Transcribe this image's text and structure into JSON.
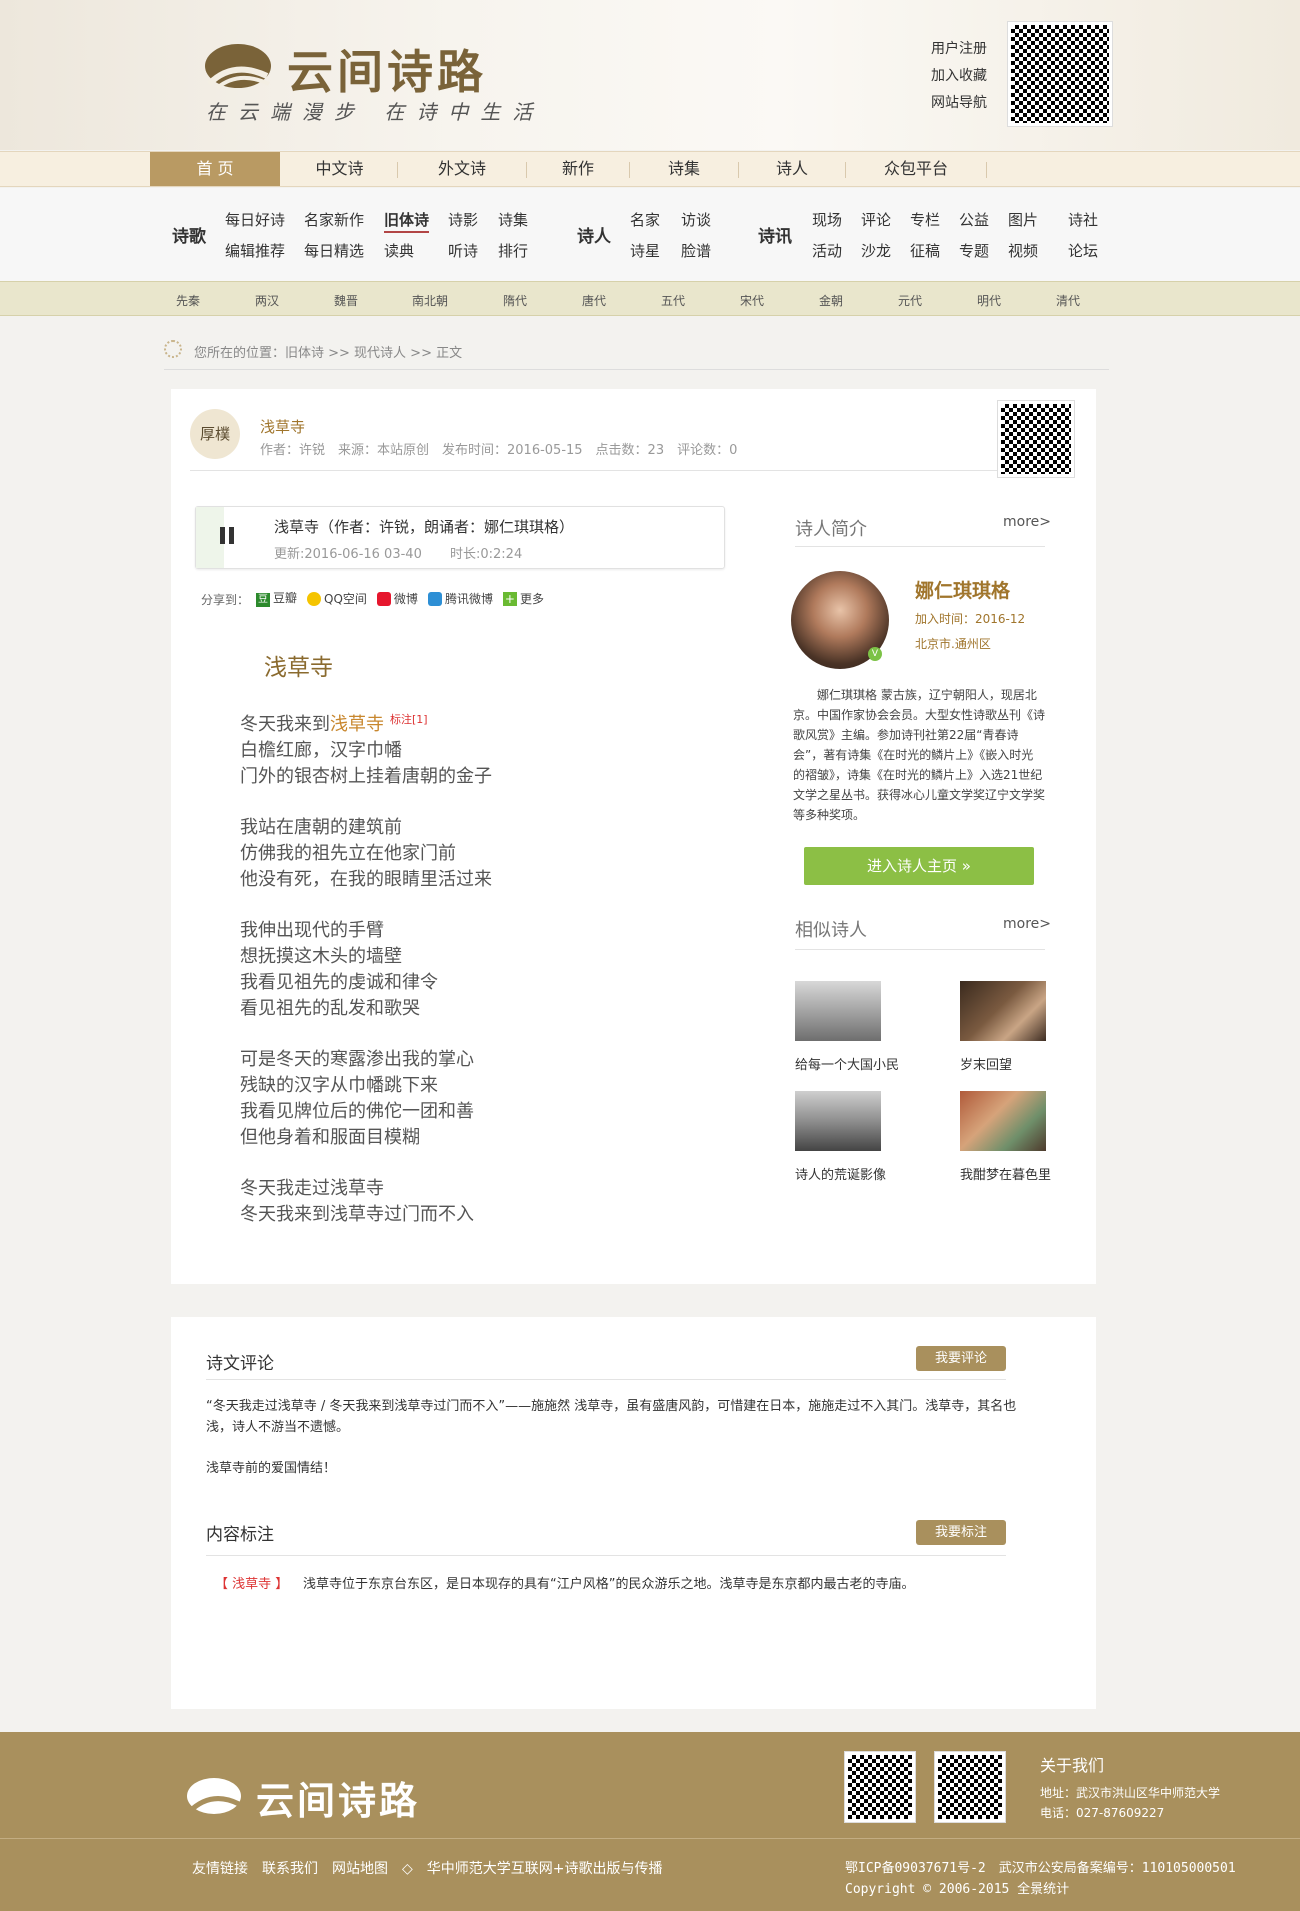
{
  "header": {
    "logo_text": "云间诗路",
    "slogan": "在云端漫步  在诗中生活",
    "links": [
      "用户注册",
      "加入收藏",
      "网站导航"
    ]
  },
  "mainnav": {
    "tabs": [
      "首 页",
      "中文诗",
      "外文诗",
      "新作",
      "诗集",
      "诗人",
      "众包平台"
    ]
  },
  "subnav": {
    "poetry": {
      "label": "诗歌",
      "row1": [
        "每日好诗",
        "名家新作",
        "旧体诗",
        "诗影",
        "诗集"
      ],
      "row2": [
        "编辑推荐",
        "每日精选",
        "读典",
        "听诗",
        "排行"
      ]
    },
    "poet": {
      "label": "诗人",
      "row1": [
        "名家",
        "访谈"
      ],
      "row2": [
        "诗星",
        "脸谱"
      ]
    },
    "news": {
      "label": "诗讯",
      "row1": [
        "现场",
        "评论",
        "专栏",
        "公益",
        "图片",
        "诗社"
      ],
      "row2": [
        "活动",
        "沙龙",
        "征稿",
        "专题",
        "视频",
        "论坛"
      ]
    },
    "dynasties": [
      "先秦",
      "两汉",
      "魏晋",
      "南北朝",
      "隋代",
      "唐代",
      "五代",
      "宋代",
      "金朝",
      "元代",
      "明代",
      "清代"
    ]
  },
  "breadcrumb": "您所在的位置：旧体诗 >> 现代诗人 >> 正文",
  "article": {
    "avatar_text": "厚樸",
    "title": "浅草寺",
    "meta": "作者：许锐　来源：本站原创　发布时间：2016-05-15　点击数：23　评论数：0",
    "audio": {
      "title": "浅草寺（作者：许锐，朗诵者：娜仁琪琪格）",
      "updated": "更新:2016-06-16 03-40",
      "duration": "时长:0:2:24"
    },
    "share": {
      "label": "分享到：",
      "items": [
        "豆瓣",
        "QQ空间",
        "微博",
        "腾讯微博",
        "更多"
      ]
    },
    "poem_title": "浅草寺",
    "first_line_prefix": "冬天我来到",
    "first_line_highlight": "浅草寺",
    "annotation_mark": "标注[1]",
    "stanzas": [
      [
        "白檐红廊，汉字巾幡",
        "门外的银杏树上挂着唐朝的金子"
      ],
      [
        "我站在唐朝的建筑前",
        "仿佛我的祖先立在他家门前",
        "他没有死，在我的眼睛里活过来"
      ],
      [
        "我伸出现代的手臂",
        "想抚摸这木头的墙壁",
        "我看见祖先的虔诚和律令",
        "看见祖先的乱发和歌哭"
      ],
      [
        "可是冬天的寒露渗出我的掌心",
        "残缺的汉字从巾幡跳下来",
        "我看见牌位后的佛佗一团和善",
        "但他身着和服面目模糊"
      ],
      [
        "冬天我走过浅草寺",
        "冬天我来到浅草寺过门而不入"
      ]
    ]
  },
  "sidebar": {
    "intro_heading": "诗人简介",
    "more": "more>",
    "poet_name": "娜仁琪琪格",
    "joined": "加入时间：2016-12",
    "location": "北京市.通州区",
    "bio": "娜仁琪琪格 蒙古族，辽宁朝阳人，现居北京。中国作家协会会员。大型女性诗歌丛刊《诗歌风赏》主编。参加诗刊社第22届“青春诗会”，著有诗集《在时光的鳞片上》《嵌入时光的褶皱》，诗集《在时光的鳞片上》入选21世纪文学之星丛书。获得冰心儿童文学奖辽宁文学奖等多种奖项。",
    "enter_button": "进入诗人主页 »",
    "similar_heading": "相似诗人",
    "similar": [
      "给每一个大国小民",
      "岁末回望",
      "诗人的荒诞影像",
      "我酣梦在暮色里"
    ]
  },
  "comments": {
    "heading": "诗文评论",
    "button": "我要评论",
    "items": [
      "“冬天我走过浅草寺 / 冬天我来到浅草寺过门而不入”——施施然 浅草寺，虽有盛唐风韵，可惜建在日本，施施走过不入其门。浅草寺，其名也浅，诗人不游当不遗憾。",
      "浅草寺前的爱国情结！"
    ]
  },
  "annotations": {
    "heading": "内容标注",
    "button": "我要标注",
    "term": "【 浅草寺 】",
    "text": "浅草寺位于东京台东区，是日本现存的具有“江户风格”的民众游乐之地。浅草寺是东京都内最古老的寺庙。"
  },
  "footer": {
    "logo_text": "云间诗路",
    "about_heading": "关于我们",
    "address": "地址：武汉市洪山区华中师范大学",
    "phone": "电话：027-87609227",
    "links": "友情链接　联系我们　网站地图　◇　华中师范大学互联网+诗歌出版与传播",
    "icp": "鄂ICP备09037671号-2　武汉市公安局备案编号：110105000501",
    "copyright": "Copyright © 2006-2015 全景统计"
  },
  "colors": {
    "brand": "#a9905d",
    "accent_green": "#8cbf45",
    "highlight": "#c8872e",
    "mark_red": "#d33"
  }
}
